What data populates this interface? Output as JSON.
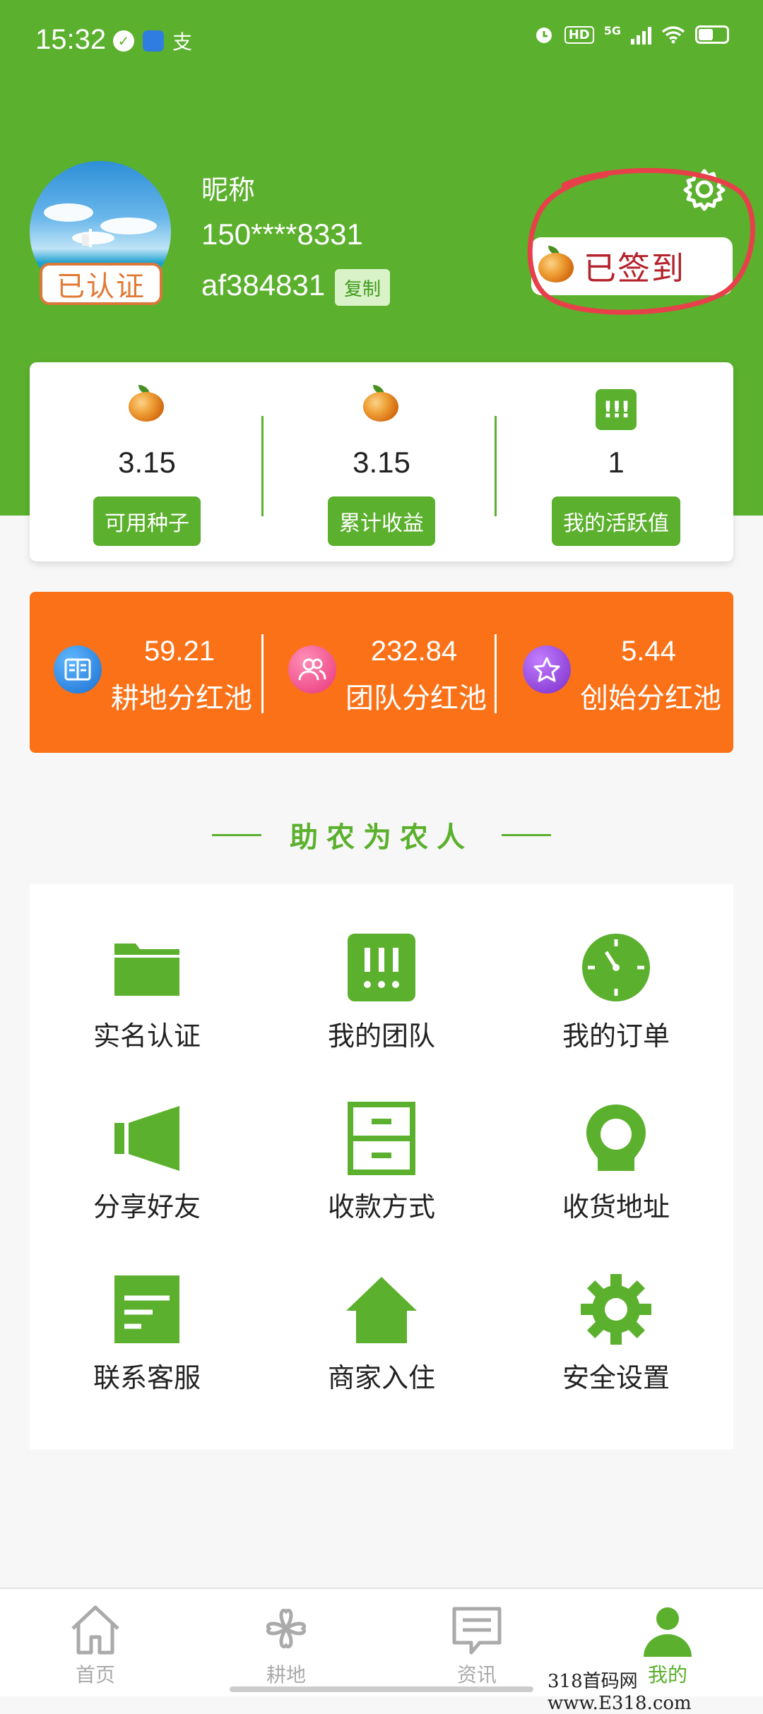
{
  "status_bar": {
    "time": "15:32",
    "pay_glyph": "支",
    "network": "5G",
    "hd": "HD"
  },
  "profile": {
    "verified_label": "已认证",
    "nickname": "昵称",
    "phone": "150****8331",
    "invite_code": "af384831",
    "copy_label": "复制",
    "signin_label": "已签到"
  },
  "stats": [
    {
      "value": "3.15",
      "label": "可用种子",
      "icon": "seed-icon"
    },
    {
      "value": "3.15",
      "label": "累计收益",
      "icon": "seed-icon"
    },
    {
      "value": "1",
      "label": "我的活跃值",
      "icon": "activity-icon",
      "icon_glyph": "!!!"
    }
  ],
  "dividends": [
    {
      "value": "59.21",
      "label": "耕地分红池",
      "icon": "book-icon",
      "color": "#1a7fe0"
    },
    {
      "value": "232.84",
      "label": "团队分红池",
      "icon": "people-icon",
      "color": "#f2548c"
    },
    {
      "value": "5.44",
      "label": "创始分红池",
      "icon": "star-icon",
      "color": "#8e3bd6"
    }
  ],
  "slogan": "助农为农人",
  "menu": [
    {
      "label": "实名认证",
      "icon": "folder-icon"
    },
    {
      "label": "我的团队",
      "icon": "team-icon",
      "icon_glyph": "!!!"
    },
    {
      "label": "我的订单",
      "icon": "clock-icon"
    },
    {
      "label": "分享好友",
      "icon": "speaker-icon"
    },
    {
      "label": "收款方式",
      "icon": "cabinet-icon"
    },
    {
      "label": "收货地址",
      "icon": "location-icon"
    },
    {
      "label": "联系客服",
      "icon": "document-icon"
    },
    {
      "label": "商家入住",
      "icon": "store-icon"
    },
    {
      "label": "安全设置",
      "icon": "gear-icon"
    }
  ],
  "bottom_nav": [
    {
      "label": "首页",
      "icon": "home-icon",
      "active": false
    },
    {
      "label": "耕地",
      "icon": "clover-icon",
      "active": false
    },
    {
      "label": "资讯",
      "icon": "news-icon",
      "active": false
    },
    {
      "label": "我的",
      "icon": "user-icon",
      "active": true
    }
  ],
  "watermark": "318首码网 www.E318.com",
  "colors": {
    "primary": "#5bb02d",
    "orange": "#fb7118",
    "signin_text": "#b4222b",
    "annotation": "#e8404a"
  }
}
